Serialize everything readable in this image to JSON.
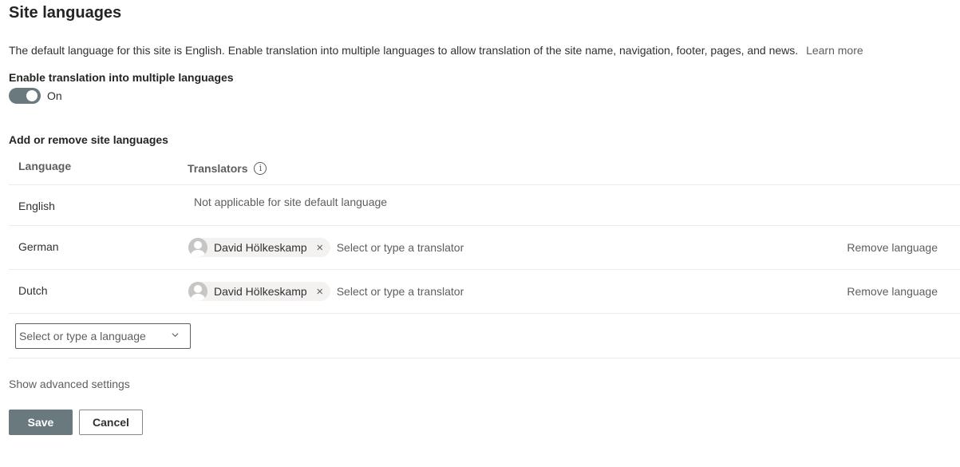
{
  "header": {
    "title": "Site languages"
  },
  "description": {
    "text": "The default language for this site is English. Enable translation into multiple languages to allow translation of the site name, navigation, footer, pages, and news.",
    "link": "Learn more"
  },
  "toggle": {
    "label": "Enable translation into multiple languages",
    "state": "On"
  },
  "languages_section": {
    "label": "Add or remove site languages",
    "columns": {
      "language": "Language",
      "translators": "Translators",
      "info_icon": "i"
    },
    "default_row": {
      "language": "English",
      "note": "Not applicable for site default language"
    },
    "rows": [
      {
        "language": "German",
        "translator": "David Hölkeskamp",
        "remove_x": "×",
        "placeholder": "Select or type a translator",
        "remove": "Remove language"
      },
      {
        "language": "Dutch",
        "translator": "David Hölkeskamp",
        "remove_x": "×",
        "placeholder": "Select or type a translator",
        "remove": "Remove language"
      }
    ],
    "add_dropdown": {
      "placeholder": "Select or type a language"
    }
  },
  "advanced": {
    "label": "Show advanced settings"
  },
  "buttons": {
    "save": "Save",
    "cancel": "Cancel"
  },
  "colors": {
    "toggle_on": "#69797e",
    "primary_button": "#69797e",
    "text": "#323130",
    "muted": "#605e5c"
  }
}
